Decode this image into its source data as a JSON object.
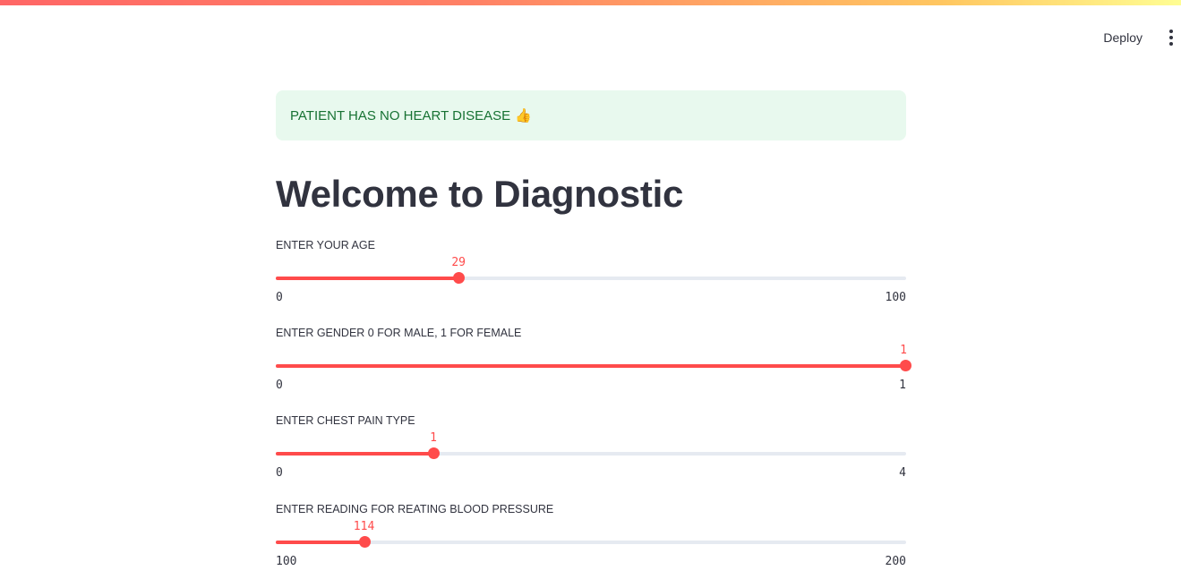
{
  "toolbar": {
    "deploy_label": "Deploy",
    "menu_icon": "more-vertical-icon"
  },
  "alert": {
    "text": "PATIENT HAS NO HEART DISEASE",
    "emoji": "👍",
    "status": "success",
    "color": "#177233",
    "background": "#e8f9ee"
  },
  "page_title": "Welcome to Diagnostic",
  "accent_color": "#ff4b4b",
  "sliders": [
    {
      "label": "ENTER YOUR AGE",
      "value": 29,
      "min": 0,
      "max": 100,
      "min_label": "0",
      "max_label": "100"
    },
    {
      "label": "ENTER GENDER 0 FOR MALE, 1 FOR FEMALE",
      "value": 1,
      "min": 0,
      "max": 1,
      "min_label": "0",
      "max_label": "1"
    },
    {
      "label": "ENTER CHEST PAIN TYPE",
      "value": 1,
      "min": 0,
      "max": 4,
      "min_label": "0",
      "max_label": "4"
    },
    {
      "label": "ENTER READING FOR REATING BLOOD PRESSURE",
      "value": 114,
      "min": 100,
      "max": 200,
      "min_label": "100",
      "max_label": "200"
    }
  ]
}
